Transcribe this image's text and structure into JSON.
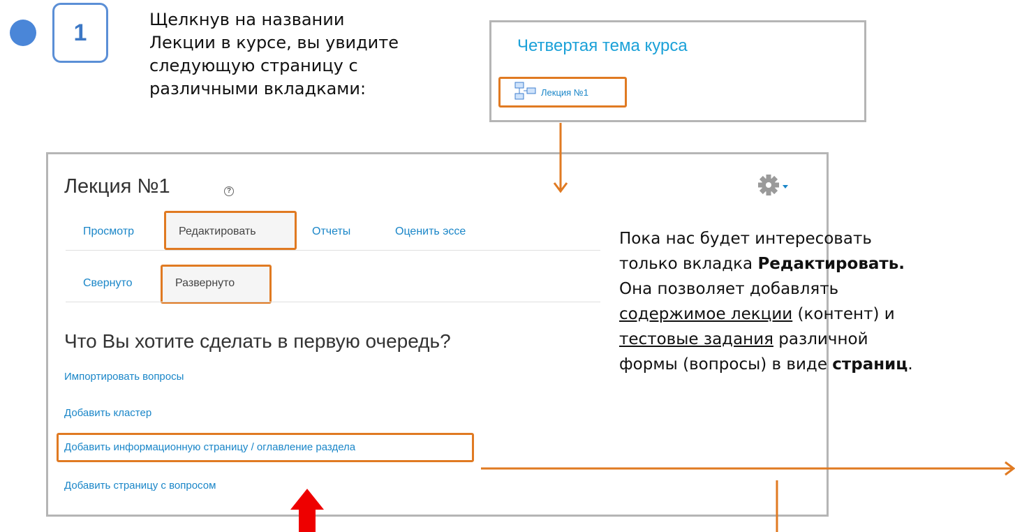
{
  "step": {
    "number": "1"
  },
  "intro": {
    "line1": "Щелкнув на названии",
    "line2": "Лекции в курсе, вы увидите",
    "line3": "следующую страницу с",
    "line4": "различными вкладками:"
  },
  "topic_panel": {
    "title": "Четвертая тема курса",
    "lecture_link": "Лекция №1"
  },
  "lecture": {
    "title": "Лекция №1",
    "help_icon": "help-icon",
    "settings_icon": "gear-icon",
    "tabs": [
      {
        "label": "Просмотр"
      },
      {
        "label": "Редактировать"
      },
      {
        "label": "Отчеты"
      },
      {
        "label": "Оценить эссе"
      }
    ],
    "subtabs": [
      {
        "label": "Свернуто"
      },
      {
        "label": "Развернуто"
      }
    ],
    "question": "Что Вы хотите сделать в первую очередь?",
    "actions": [
      {
        "label": "Импортировать вопросы"
      },
      {
        "label": "Добавить кластер"
      },
      {
        "label": "Добавить информационную страницу / оглавление раздела"
      },
      {
        "label": "Добавить страницу с вопросом"
      }
    ]
  },
  "explanation": {
    "l1": "Пока нас будет интересовать",
    "l2_a": "только вкладка ",
    "l2_b": "Редактировать.",
    "l3": "Она позволяет добавлять",
    "l4_u": "содержимое лекции",
    "l4_b": " (контент) и",
    "l5_u": "тестовые задания",
    "l5_b": " различной",
    "l6_a": "формы (вопросы) в виде ",
    "l6_b": "страниц",
    "l6_c": "."
  },
  "colors": {
    "highlight": "#e07a22",
    "link": "#1a86c8",
    "step": "#4a86d8",
    "arrow_red": "#ee0000"
  }
}
